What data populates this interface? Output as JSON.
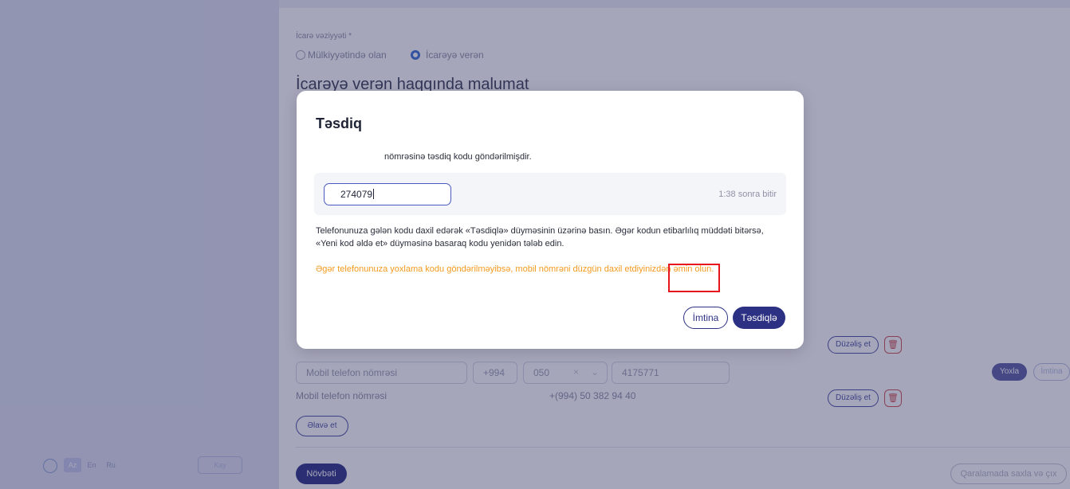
{
  "background": {
    "rental_status_label": "İcarə vəziyyəti *",
    "radio_owned": "Mülkiyyətində olan",
    "radio_lessor": "İcarəyə verən",
    "section_title": "İcarəyə verən haqqında malumat",
    "edit_label": "Düzəliş et",
    "mobile_placeholder": "Mobil telefon nömrəsi",
    "country_code": "+994",
    "operator_code": "050",
    "number_value": "4175771",
    "check_label": "Yoxla",
    "cancel_small": "İmtina",
    "saved_mobile_label": "Mobil telefon nömrəsi",
    "saved_mobile_value": "+(994) 50 382 94 40",
    "add_label": "Əlavə et",
    "next_label": "Növbəti",
    "save_exit_label": "Qaralamada saxla və çıx",
    "lang_az": "Az",
    "lang_en": "En",
    "lang_ru": "Ru",
    "login_label": "Kay"
  },
  "modal": {
    "title": "Təsdiq",
    "sent_text": "nömrəsinə təsdiq kodu göndərilmişdir.",
    "code_value": "274079",
    "timer": "1:38 sonra bitir",
    "info_text": "Telefonunuza gələn kodu daxil edərək «Təsdiqlə» düyməsinin üzərinə basın. Əgər kodun etibarlılıq müddəti bitərsə, «Yeni kod əldə et» düyməsinə basaraq kodu yenidən tələb edin.",
    "warning_text": "Əgər telefonunuza yoxlama kodu göndərilməyibsə, mobil nömrəni düzgün daxil etdiyinizdən əmin olun.",
    "cancel_label": "İmtina",
    "confirm_label": "Təsdiqlə"
  },
  "colors": {
    "primary": "#2d3183",
    "warning": "#f39a1d",
    "highlight": "#e8141c"
  }
}
